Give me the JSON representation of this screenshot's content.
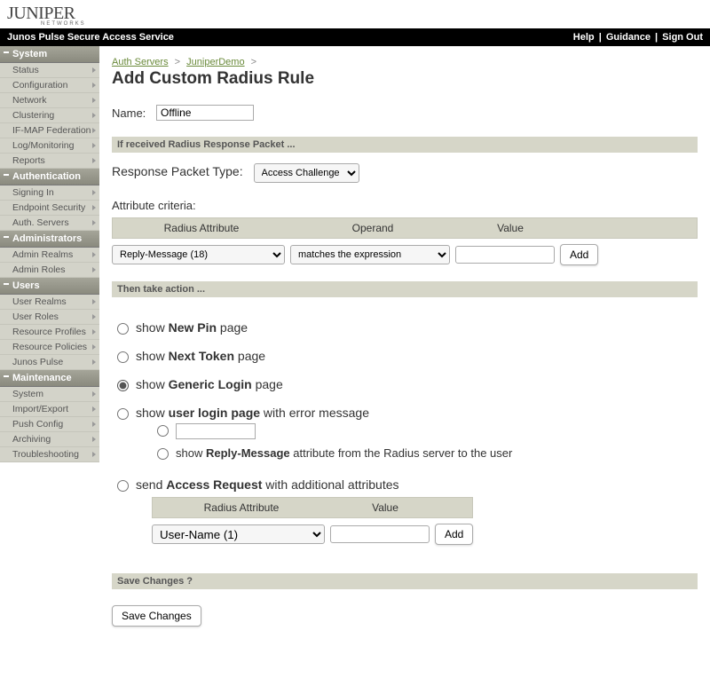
{
  "brand": {
    "name": "JUNIPER",
    "sub": "NETWORKS"
  },
  "topbar": {
    "title": "Junos Pulse Secure Access Service",
    "links": {
      "help": "Help",
      "guidance": "Guidance",
      "signout": "Sign Out"
    }
  },
  "sidebar": [
    {
      "section": "System",
      "items": [
        "Status",
        "Configuration",
        "Network",
        "Clustering",
        "IF-MAP Federation",
        "Log/Monitoring",
        "Reports"
      ]
    },
    {
      "section": "Authentication",
      "items": [
        "Signing In",
        "Endpoint Security",
        "Auth. Servers"
      ]
    },
    {
      "section": "Administrators",
      "items": [
        "Admin Realms",
        "Admin Roles"
      ]
    },
    {
      "section": "Users",
      "items": [
        "User Realms",
        "User Roles",
        "Resource Profiles",
        "Resource Policies",
        "Junos Pulse"
      ]
    },
    {
      "section": "Maintenance",
      "items": [
        "System",
        "Import/Export",
        "Push Config",
        "Archiving",
        "Troubleshooting"
      ]
    }
  ],
  "breadcrumb": {
    "root": "Auth Servers",
    "mid": "JuniperDemo",
    "sep": ">"
  },
  "page_title": "Add Custom Radius Rule",
  "name_field": {
    "label": "Name:",
    "value": "Offline"
  },
  "section_if": "If received Radius Response Packet ...",
  "response": {
    "label": "Response Packet Type:",
    "options": [
      "Access Challenge"
    ],
    "selected": "Access Challenge"
  },
  "criteria": {
    "label": "Attribute criteria:",
    "headers": {
      "attr": "Radius Attribute",
      "op": "Operand",
      "val": "Value"
    },
    "row": {
      "attr_options": [
        "Reply-Message (18)"
      ],
      "attr_selected": "Reply-Message (18)",
      "op_options": [
        "matches the expression"
      ],
      "op_selected": "matches the expression",
      "value": ""
    },
    "add_label": "Add"
  },
  "section_then": "Then take action ...",
  "actions": {
    "new_pin": {
      "pre": "show ",
      "b": "New Pin",
      "post": " page"
    },
    "next_token": {
      "pre": "show ",
      "b": "Next Token",
      "post": " page"
    },
    "generic": {
      "pre": "show ",
      "b": "Generic Login",
      "post": " page"
    },
    "user_login": {
      "pre": "show ",
      "b": "user login page",
      "post": " with error message"
    },
    "user_login_sub2": {
      "pre": "show ",
      "b": "Reply-Message",
      "post": " attribute from the Radius server to the user"
    },
    "access_req": {
      "pre": "send ",
      "b": "Access Request",
      "post": " with additional attributes"
    },
    "inner": {
      "headers": {
        "attr": "Radius Attribute",
        "val": "Value"
      },
      "attr_options": [
        "User-Name (1)"
      ],
      "attr_selected": "User-Name (1)",
      "value": "",
      "add_label": "Add"
    }
  },
  "section_save": "Save Changes ?",
  "save_label": "Save Changes"
}
